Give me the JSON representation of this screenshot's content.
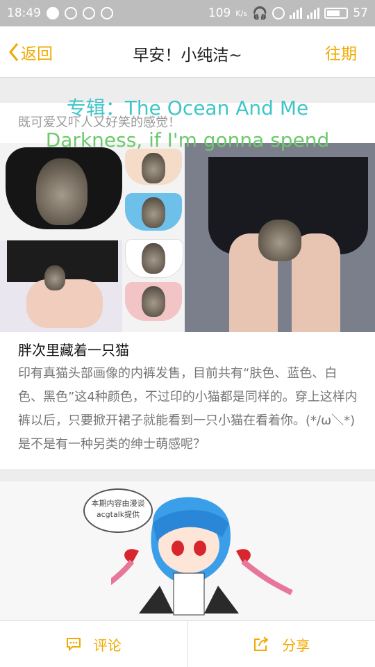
{
  "status_bar": {
    "time": "18:49",
    "speed": "109",
    "speed_unit": "K/s",
    "battery": "57"
  },
  "nav": {
    "back_label": "返回",
    "title": "早安！小纯洁~",
    "right_label": "往期"
  },
  "overlay": {
    "line1": "专辑：The Ocean And Me",
    "line2": "Darkness, if I'm gonna spend"
  },
  "article": {
    "intro": "既可爱又吓人又好笑的感觉！",
    "title": "胖次里藏着一只猫",
    "desc": "印有真猫头部画像的内裤发售，目前共有“肤色、蓝色、白色、黑色”这4种颜色，不过印的小猫都是同样的。穿上这样内裤以后，只要掀开裙子就能看到一只小猫在看着你。(*/ω＼*)是不是有一种另类的绅士萌感呢？"
  },
  "illustration": {
    "bubble_text": "本期内容由漫谈acgtalk提供"
  },
  "bottom_bar": {
    "comment_label": "评论",
    "share_label": "分享"
  },
  "colors": {
    "accent": "#f2a900",
    "overlay_cyan": "#3fc5c8",
    "overlay_green": "#6ec96d"
  }
}
